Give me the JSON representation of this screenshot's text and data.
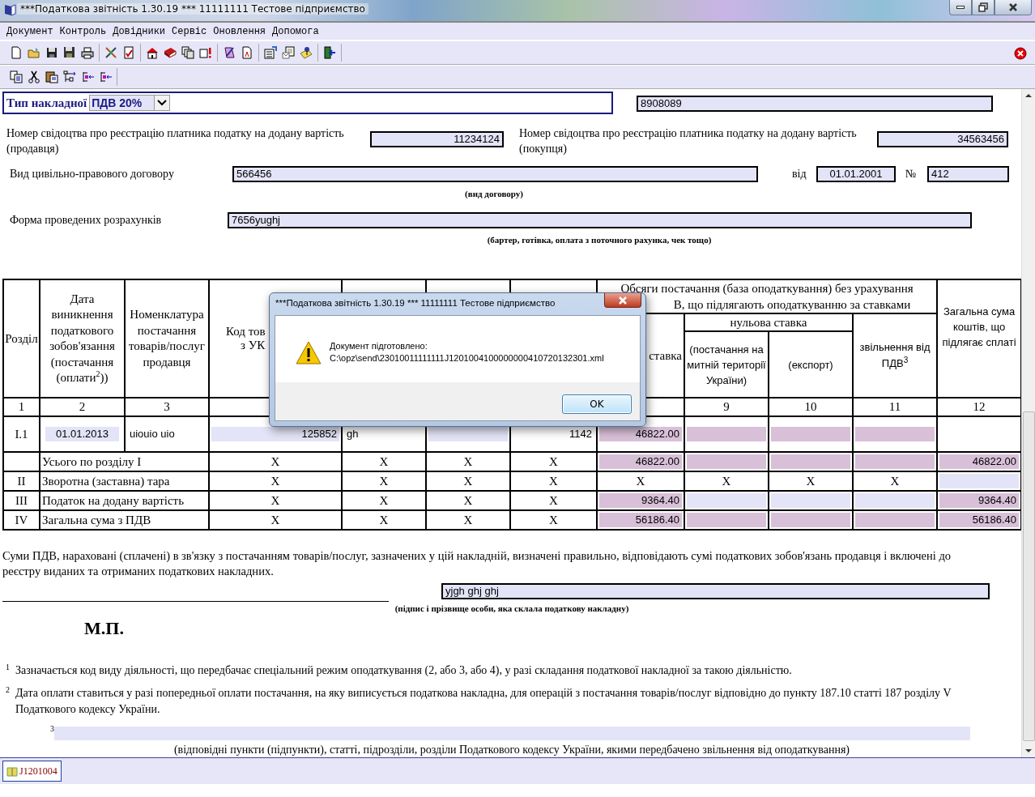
{
  "window": {
    "title": "***Податкова звітність 1.30.19 *** 11111111 Тестове підприємство"
  },
  "menu": [
    "Документ",
    "Контроль",
    "Довідники",
    "Сервіс",
    "Оновлення",
    "Допомога"
  ],
  "form": {
    "invoice_type": {
      "label": "Тип накладної",
      "value": "ПДВ 20%"
    },
    "number_field": {
      "value": "8908089"
    },
    "seller_cert": {
      "label": "Номер свідоцтва про реєстрацію платника податку на додану вартість (продавця)",
      "value": "11234124"
    },
    "buyer_cert": {
      "label": "Номер свідоцтва про реєстрацію платника податку на додану вартість (покупця)",
      "value": "34563456"
    },
    "contract": {
      "label": "Вид цивільно-правового договору",
      "value": "566456",
      "caption": "(вид договору)",
      "date_label": "від",
      "date": "01.01.2001",
      "number_label": "№",
      "number": "412"
    },
    "payment_form": {
      "label": "Форма проведених розрахунків",
      "value": "7656yughj",
      "caption": "(бартер, готівка, оплата з поточного рахунка, чек тощо)"
    }
  },
  "table": {
    "header": {
      "section": "Розділ",
      "date": "Дата виникнення податкового зобов'язання (постачання (оплати$^{2}$))",
      "nomenclature": "Номенклатура постачання товарів/послуг продавця",
      "code_line_1": "Код тов",
      "code_line_2": "з УК",
      "volume_line_1": "Обсяги постачання (база оподаткування) без урахування",
      "volume_line_2": "В, що підлягають оподаткуванню за ставками",
      "rate": "ставка",
      "zero_rate": "нульова ставка",
      "customs": "(постачання на митній території України)",
      "export": "(експорт)",
      "exempt": "звільнення від ПДВ$^{3}$",
      "total": "Загальна сума коштів, що підлягає сплаті"
    },
    "number_row": [
      "1",
      "2",
      "3"
    ],
    "number_row_end": [
      "9",
      "10",
      "11",
      "12"
    ],
    "rows": [
      {
        "cells": [
          {
            "kind": "section",
            "value": "I.1"
          },
          {
            "kind": "date",
            "value": "01.01.2013"
          },
          {
            "kind": "text",
            "value": "uiouio uio"
          },
          {
            "kind": "amount",
            "value": "125852"
          },
          {
            "kind": "text",
            "value": "gh"
          },
          {
            "kind": "input"
          },
          {
            "kind": "number",
            "value": "1142"
          },
          {
            "kind": "calc",
            "value": "46822.00"
          },
          {
            "kind": "calc"
          },
          {
            "kind": "calc"
          },
          {
            "kind": "calc"
          },
          {
            "kind": "blank"
          }
        ]
      },
      {
        "cells": [
          {
            "kind": "blank"
          },
          {
            "kind": "label",
            "value": "Усього по розділу I"
          },
          {
            "kind": "blank"
          },
          {
            "kind": "x",
            "value": "X"
          },
          {
            "kind": "x",
            "value": "X"
          },
          {
            "kind": "x",
            "value": "X"
          },
          {
            "kind": "x",
            "value": "X"
          },
          {
            "kind": "calc",
            "value": "46822.00"
          },
          {
            "kind": "calc"
          },
          {
            "kind": "calc"
          },
          {
            "kind": "calc"
          },
          {
            "kind": "calc",
            "value": "46822.00"
          }
        ]
      },
      {
        "cells": [
          {
            "kind": "section",
            "value": "II"
          },
          {
            "kind": "label",
            "value": "Зворотна (заставна) тара"
          },
          {
            "kind": "blank"
          },
          {
            "kind": "x",
            "value": "X"
          },
          {
            "kind": "x",
            "value": "X"
          },
          {
            "kind": "x",
            "value": "X"
          },
          {
            "kind": "x",
            "value": "X"
          },
          {
            "kind": "x",
            "value": "X"
          },
          {
            "kind": "x",
            "value": "X"
          },
          {
            "kind": "x",
            "value": "X"
          },
          {
            "kind": "x",
            "value": "X"
          },
          {
            "kind": "input"
          }
        ]
      },
      {
        "cells": [
          {
            "kind": "section",
            "value": "III"
          },
          {
            "kind": "label",
            "value": "Податок на додану вартість"
          },
          {
            "kind": "blank"
          },
          {
            "kind": "x",
            "value": "X"
          },
          {
            "kind": "x",
            "value": "X"
          },
          {
            "kind": "x",
            "value": "X"
          },
          {
            "kind": "x",
            "value": "X"
          },
          {
            "kind": "calc",
            "value": "9364.40"
          },
          {
            "kind": "input"
          },
          {
            "kind": "input"
          },
          {
            "kind": "input"
          },
          {
            "kind": "calc",
            "value": "9364.40"
          }
        ]
      },
      {
        "cells": [
          {
            "kind": "section",
            "value": "IV"
          },
          {
            "kind": "label",
            "value": "Загальна сума з ПДВ"
          },
          {
            "kind": "blank"
          },
          {
            "kind": "x",
            "value": "X"
          },
          {
            "kind": "x",
            "value": "X"
          },
          {
            "kind": "x",
            "value": "X"
          },
          {
            "kind": "x",
            "value": "X"
          },
          {
            "kind": "calc",
            "value": "56186.40"
          },
          {
            "kind": "calc"
          },
          {
            "kind": "calc"
          },
          {
            "kind": "calc"
          },
          {
            "kind": "calc",
            "value": "56186.40"
          }
        ]
      }
    ]
  },
  "statement": "Суми ПДВ, нараховані (сплачені) в зв'язку з постачанням товарів/послуг, зазначених у цій накладній, визначені правильно, відповідають сумі податкових зобов'язань продавця і включені до реєстру виданих та отриманих податкових накладних.",
  "signature": {
    "value": "yjgh ghj ghj",
    "caption": "(підпис і прізвище особи, яка склала податкову накладну)"
  },
  "stamp": "М.П.",
  "footnotes": [
    {
      "kind": "text",
      "mark": "1",
      "text": "Зазначається код виду діяльності, що передбачає спеціальний режим оподаткування (2, або 3, або 4), у разі складання податкової накладної за такою діяльністю."
    },
    {
      "kind": "text",
      "mark": "2",
      "text": "Дата оплати ставиться у разі попередньої оплати постачання, на яку виписується податкова накладна, для операцій з постачання товарів/послуг відповідно до пункту 187.10 статті 187 розділу V Податкового кодексу України."
    },
    {
      "kind": "field",
      "mark": "3",
      "caption": "(відповідні пункти (підпункти), статті, підрозділи, розділи Податкового кодексу України, якими передбачено звільнення від оподаткування)"
    }
  ],
  "dialog": {
    "title": "***Податкова звітність 1.30.19 *** 11111111 Тестове підприємство",
    "lines": [
      "Документ підготовлено:",
      "C:\\opz\\send\\23010011111111J1201004100000000410720132301.xml"
    ],
    "button": "OK"
  },
  "doc_tabs": [
    {
      "label": "J1201004",
      "selected": true
    }
  ]
}
